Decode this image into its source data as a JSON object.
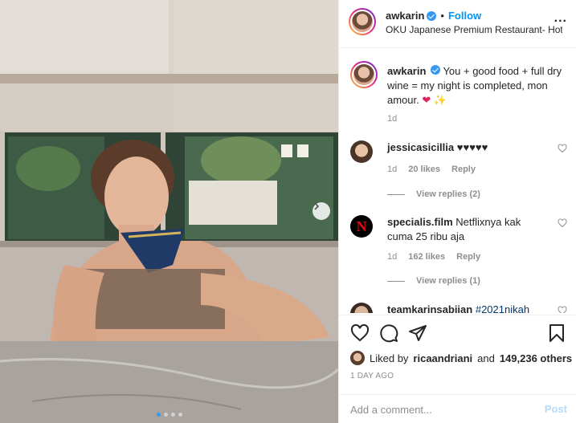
{
  "post": {
    "author": "awkarin",
    "follow_label": "Follow",
    "separator": "•",
    "location": "OKU Japanese Premium Restaurant- Hotel...",
    "more_label": "...",
    "caption_text": "You + good food + full dry wine = my night is completed, mon amour.",
    "caption_emoji_heart": "❤",
    "caption_emoji_sparkle": "✨",
    "caption_time": "1d"
  },
  "comments": [
    {
      "username": "jessicasicillia",
      "text": "♥♥♥♥♥",
      "time": "1d",
      "likes": "20 likes",
      "reply_label": "Reply",
      "view_replies": "View replies (2)"
    },
    {
      "username": "specialis.film",
      "text": "Netflixnya kak cuma 25 ribu aja",
      "avatar_letter": "N",
      "time": "1d",
      "likes": "162 likes",
      "reply_label": "Reply",
      "view_replies": "View replies (1)"
    },
    {
      "username": "teamkarinsabiian",
      "text": "#2021nikah"
    }
  ],
  "likes": {
    "prefix": "Liked by",
    "user": "ricaandriani",
    "joiner": "and",
    "count": "149,236 others"
  },
  "post_date": "1 DAY AGO",
  "add_comment": {
    "placeholder": "Add a comment...",
    "post_label": "Post"
  },
  "carousel": {
    "total": 4,
    "active_index": 0
  },
  "colors": {
    "accent": "#0095f6",
    "verified": "#3897f0",
    "netflix_red": "#e50914"
  }
}
